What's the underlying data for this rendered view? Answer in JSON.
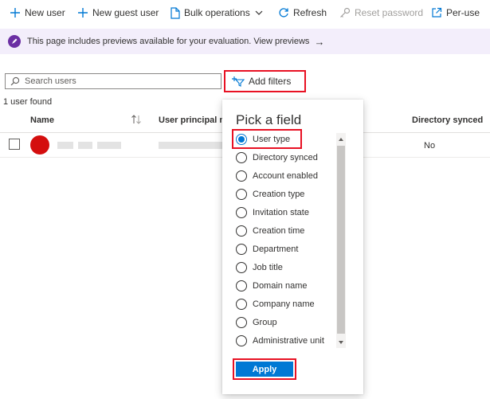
{
  "toolbar": {
    "new_user": "New user",
    "new_guest_user": "New guest user",
    "bulk_operations": "Bulk operations",
    "refresh": "Refresh",
    "reset_password": "Reset password",
    "per_user": "Per-use"
  },
  "banner": {
    "text": "This page includes previews available for your evaluation. View previews",
    "arrow": "→",
    "icon_color": "#6b2fa3"
  },
  "search": {
    "placeholder": "Search users"
  },
  "add_filters": {
    "label": "Add filters"
  },
  "result_count": "1 user found",
  "table": {
    "columns": {
      "name": "Name",
      "upn": "User principal n",
      "directory_synced": "Directory synced"
    },
    "rows": [
      {
        "directory_synced": "No"
      }
    ]
  },
  "filter_panel": {
    "title": "Pick a field",
    "selected": "User type",
    "options": [
      "User type",
      "Directory synced",
      "Account enabled",
      "Creation type",
      "Invitation state",
      "Creation time",
      "Department",
      "Job title",
      "Domain name",
      "Company name",
      "Group",
      "Administrative unit"
    ],
    "apply_label": "Apply"
  },
  "colors": {
    "accent": "#0078d4",
    "highlight": "#e81123"
  }
}
